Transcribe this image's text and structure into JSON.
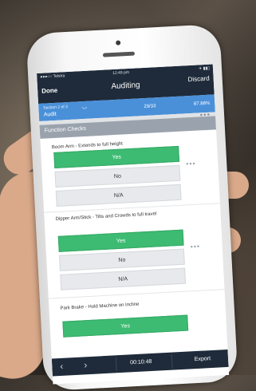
{
  "status_bar": {
    "carrier": "●●●○○ Telstra",
    "time": "12:49 pm",
    "battery": "✈ ▮▮▯"
  },
  "navbar": {
    "title": "Auditing",
    "done_label": "Done",
    "discard_label": "Discard"
  },
  "section": {
    "subtitle": "Section 2 of 3",
    "name": "Audit",
    "count": "29/33",
    "percent": "87.88%"
  },
  "category": {
    "title": "Function Checks",
    "more": "•••"
  },
  "questions": [
    {
      "text": "Boom Arm - Extends to full height",
      "options": [
        "Yes",
        "No",
        "N/A"
      ],
      "selected": "Yes"
    },
    {
      "text": "Dipper Arm/Stick - Tilts and Crowds to full travel",
      "options": [
        "Yes",
        "No",
        "N/A"
      ],
      "selected": "Yes"
    },
    {
      "text": "Park Brake - Hold Machine on Incline",
      "options": [
        "Yes"
      ],
      "selected": "Yes"
    }
  ],
  "more_glyph": "•••",
  "bottom_bar": {
    "prev": "‹",
    "next": "›",
    "timer": "00:10:48",
    "export_label": "Export"
  },
  "colors": {
    "navbar": "#1f2b3a",
    "section": "#4a90d9",
    "selected": "#3dbb72",
    "header": "#9aa3ad"
  }
}
